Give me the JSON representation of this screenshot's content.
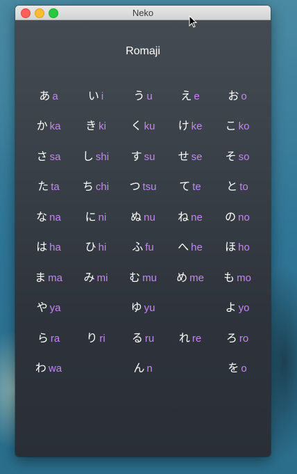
{
  "window": {
    "title": "Neko",
    "mode_label": "Romaji"
  },
  "colors": {
    "kana": "#ffffff",
    "romaji": "#c287f0",
    "window_bg_top": "#454c52",
    "window_bg_bottom": "#2a2f37"
  },
  "rows": [
    [
      {
        "k": "あ",
        "r": "a"
      },
      {
        "k": "い",
        "r": "i"
      },
      {
        "k": "う",
        "r": "u"
      },
      {
        "k": "え",
        "r": "e"
      },
      {
        "k": "お",
        "r": "o"
      }
    ],
    [
      {
        "k": "か",
        "r": "ka"
      },
      {
        "k": "き",
        "r": "ki"
      },
      {
        "k": "く",
        "r": "ku"
      },
      {
        "k": "け",
        "r": "ke"
      },
      {
        "k": "こ",
        "r": "ko"
      }
    ],
    [
      {
        "k": "さ",
        "r": "sa"
      },
      {
        "k": "し",
        "r": "shi"
      },
      {
        "k": "す",
        "r": "su"
      },
      {
        "k": "せ",
        "r": "se"
      },
      {
        "k": "そ",
        "r": "so"
      }
    ],
    [
      {
        "k": "た",
        "r": "ta"
      },
      {
        "k": "ち",
        "r": "chi"
      },
      {
        "k": "つ",
        "r": "tsu"
      },
      {
        "k": "て",
        "r": "te"
      },
      {
        "k": "と",
        "r": "to"
      }
    ],
    [
      {
        "k": "な",
        "r": "na"
      },
      {
        "k": "に",
        "r": "ni"
      },
      {
        "k": "ぬ",
        "r": "nu"
      },
      {
        "k": "ね",
        "r": "ne"
      },
      {
        "k": "の",
        "r": "no"
      }
    ],
    [
      {
        "k": "は",
        "r": "ha"
      },
      {
        "k": "ひ",
        "r": "hi"
      },
      {
        "k": "ふ",
        "r": "fu"
      },
      {
        "k": "へ",
        "r": "he"
      },
      {
        "k": "ほ",
        "r": "ho"
      }
    ],
    [
      {
        "k": "ま",
        "r": "ma"
      },
      {
        "k": "み",
        "r": "mi"
      },
      {
        "k": "む",
        "r": "mu"
      },
      {
        "k": "め",
        "r": "me"
      },
      {
        "k": "も",
        "r": "mo"
      }
    ],
    [
      {
        "k": "や",
        "r": "ya"
      },
      {
        "k": "",
        "r": ""
      },
      {
        "k": "ゆ",
        "r": "yu"
      },
      {
        "k": "",
        "r": ""
      },
      {
        "k": "よ",
        "r": "yo"
      }
    ],
    [
      {
        "k": "ら",
        "r": "ra"
      },
      {
        "k": "り",
        "r": "ri"
      },
      {
        "k": "る",
        "r": "ru"
      },
      {
        "k": "れ",
        "r": "re"
      },
      {
        "k": "ろ",
        "r": "ro"
      }
    ],
    [
      {
        "k": "わ",
        "r": "wa"
      },
      {
        "k": "",
        "r": ""
      },
      {
        "k": "ん",
        "r": "n"
      },
      {
        "k": "",
        "r": ""
      },
      {
        "k": "を",
        "r": "o"
      }
    ]
  ]
}
